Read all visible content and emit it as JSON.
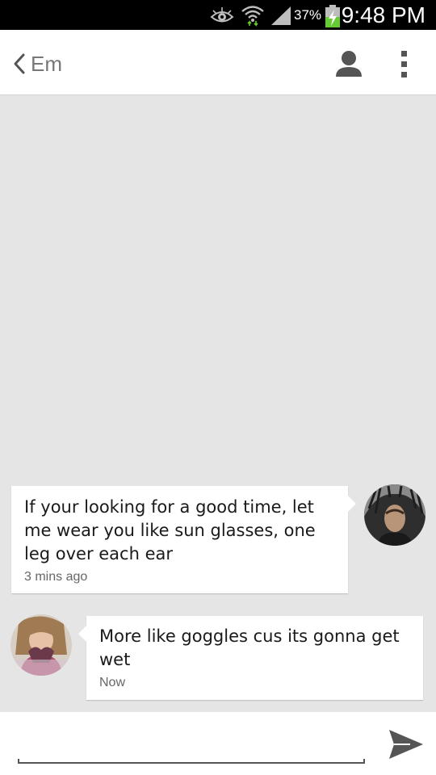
{
  "status_bar": {
    "battery_percent": "37%",
    "time": "9:48 PM",
    "icons": [
      "eye-icon",
      "wifi-icon",
      "signal-icon",
      "battery-charging-icon"
    ]
  },
  "header": {
    "back_icon": "chevron-left-icon",
    "contact_name": "Em",
    "contact_icon": "person-icon",
    "menu_icon": "overflow-menu-icon"
  },
  "messages": [
    {
      "direction": "sent",
      "text": "If your looking for a good time, let me wear you like sun glasses, one leg over each ear",
      "time": "3 mins ago"
    },
    {
      "direction": "received",
      "text": "More like goggles cus its gonna get wet",
      "time": "Now"
    }
  ],
  "composer": {
    "input_value": "",
    "send_icon": "send-icon"
  },
  "colors": {
    "status_bar_bg": "#000000",
    "header_bg": "#ffffff",
    "conversation_bg": "#e5e5e5",
    "bubble_bg": "#ffffff",
    "text": "#1a1a1a",
    "timestamp": "#666666",
    "icon_gray": "#555555",
    "battery_green": "#66cc33"
  }
}
